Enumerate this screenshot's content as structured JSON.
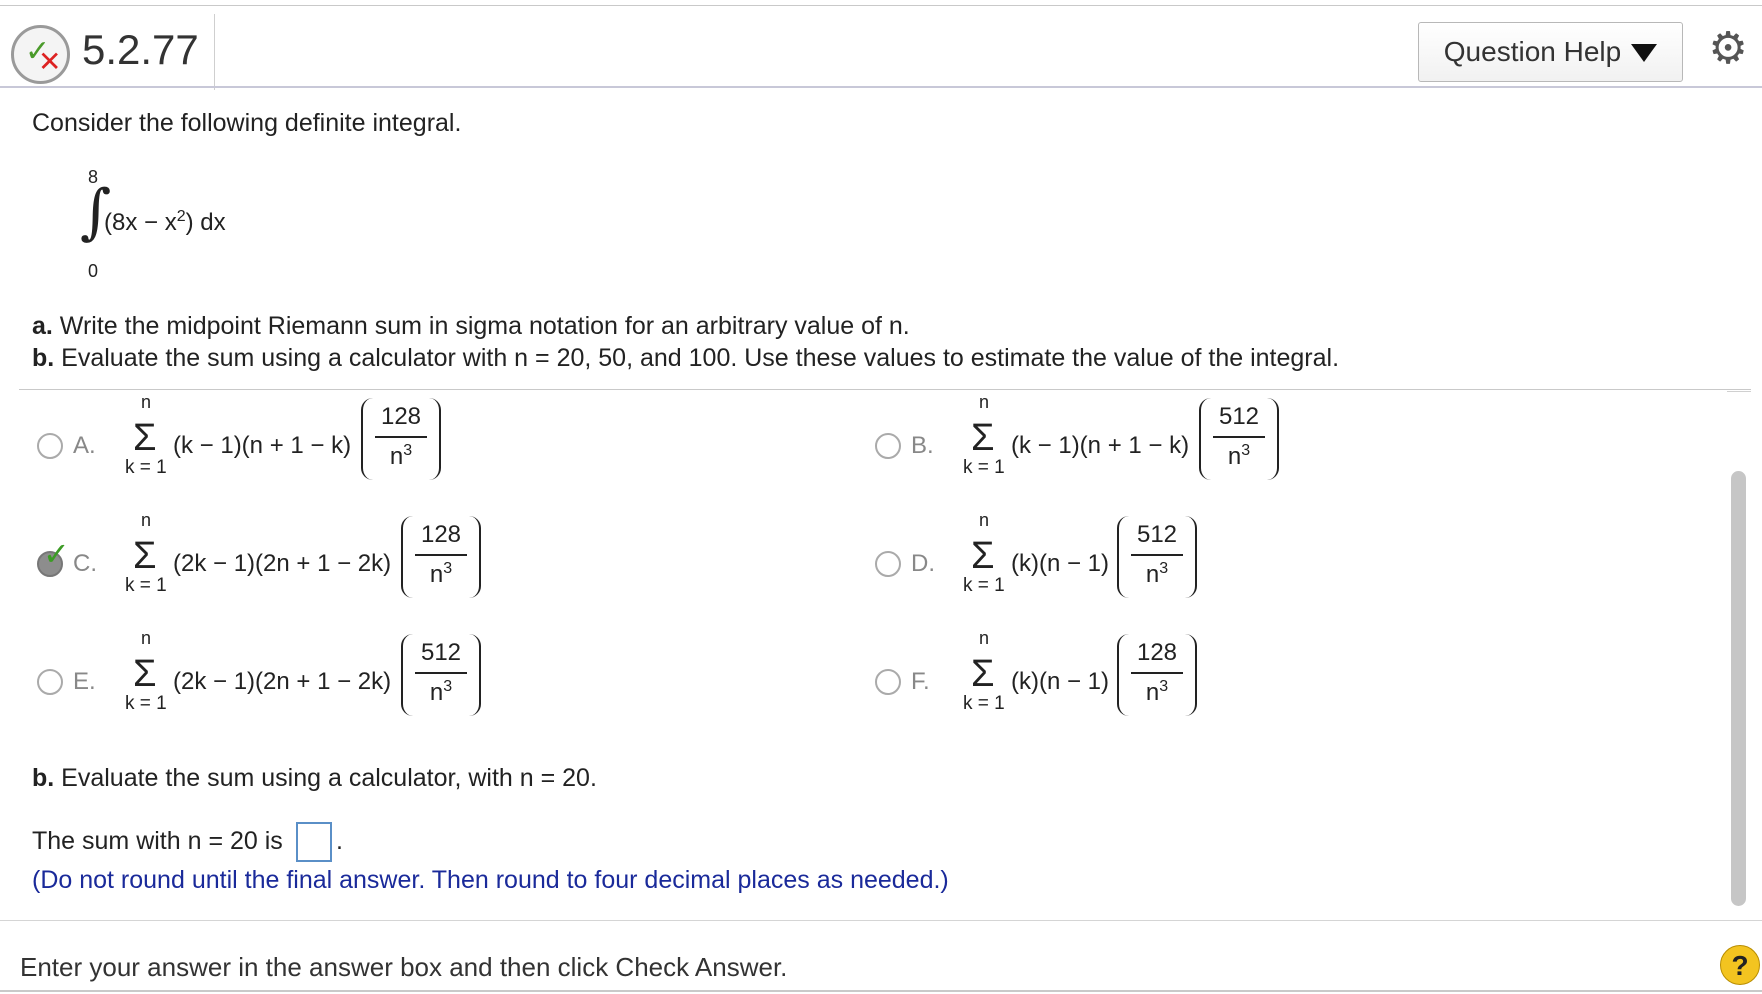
{
  "header": {
    "question_number": "5.2.77",
    "help_button": "Question Help",
    "status_icon": "partially-correct-icon",
    "settings_icon": "gear-icon"
  },
  "problem": {
    "intro": "Consider the following definite integral.",
    "integral": {
      "upper": "8",
      "lower": "0",
      "integrand": "(8x − x",
      "exponent": "2",
      "close": ") dx"
    },
    "part_a_label": "a.",
    "part_a_text": " Write the midpoint Riemann sum in sigma notation for an arbitrary value of n.",
    "part_b_label": "b.",
    "part_b_text": " Evaluate the sum using a calculator with n = 20, 50, and 100. Use these values to estimate the value of the integral."
  },
  "choices": [
    {
      "letter": "A.",
      "sigma_top": "n",
      "sigma_bottom": "k = 1",
      "expression": "(k − 1)(n + 1 − k)",
      "numerator": "128",
      "denominator": "n",
      "den_exp": "3",
      "selected": false
    },
    {
      "letter": "B.",
      "sigma_top": "n",
      "sigma_bottom": "k = 1",
      "expression": "(k − 1)(n + 1 − k)",
      "numerator": "512",
      "denominator": "n",
      "den_exp": "3",
      "selected": false
    },
    {
      "letter": "C.",
      "sigma_top": "n",
      "sigma_bottom": "k = 1",
      "expression": "(2k − 1)(2n + 1 − 2k)",
      "numerator": "128",
      "denominator": "n",
      "den_exp": "3",
      "selected": true
    },
    {
      "letter": "D.",
      "sigma_top": "n",
      "sigma_bottom": "k = 1",
      "expression": "(k)(n − 1)",
      "numerator": "512",
      "denominator": "n",
      "den_exp": "3",
      "selected": false
    },
    {
      "letter": "E.",
      "sigma_top": "n",
      "sigma_bottom": "k = 1",
      "expression": "(2k − 1)(2n + 1 − 2k)",
      "numerator": "512",
      "denominator": "n",
      "den_exp": "3",
      "selected": false
    },
    {
      "letter": "F.",
      "sigma_top": "n",
      "sigma_bottom": "k = 1",
      "expression": "(k)(n − 1)",
      "numerator": "128",
      "denominator": "n",
      "den_exp": "3",
      "selected": false
    }
  ],
  "part_b2": {
    "label": "b.",
    "text": " Evaluate the sum using a calculator, with n = 20.",
    "sum_prefix": "The sum with n = 20 is ",
    "answer_value": "",
    "sum_suffix": ".",
    "hint": "(Do not round until the final answer. Then round to four decimal places as needed.)"
  },
  "footer": {
    "instruction": "Enter your answer in the answer box and then click Check Answer.",
    "help_symbol": "?"
  }
}
